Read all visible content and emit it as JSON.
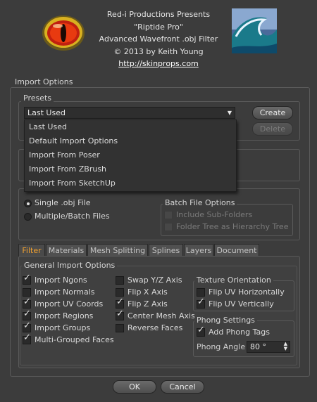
{
  "header": {
    "line1": "Red-i Productions Presents",
    "line2": "\"Riptide Pro\"",
    "line3": "Advanced Wavefront .obj Filter",
    "line4": "© 2013 by Keith Young",
    "link": "http://skinprops.com"
  },
  "import_options": {
    "legend": "Import Options",
    "presets": {
      "legend": "Presets",
      "selected": "Last Used",
      "create_label": "Create",
      "delete_label": "Delete",
      "options": [
        "Last Used",
        "Default Import Options",
        "Import From Poser",
        "Import From ZBrush",
        "Import From SketchUp"
      ]
    },
    "mode": {
      "single_label": "Single .obj File",
      "multiple_label": "Multiple/Batch Files",
      "batch_legend": "Batch File Options",
      "include_sub_folders": "Include Sub-Folders",
      "folder_tree": "Folder Tree as Hierarchy Tree"
    }
  },
  "tabs": [
    "Filter",
    "Materials",
    "Mesh Splitting",
    "Splines",
    "Layers",
    "Document"
  ],
  "general": {
    "legend": "General Import Options",
    "col1": [
      "Import Ngons",
      "Import Normals",
      "Import UV Coords",
      "Import Regions",
      "Import Groups",
      "Multi-Grouped Faces"
    ],
    "col2": [
      "Swap Y/Z Axis",
      "Flip X Axis",
      "Flip Z Axis",
      "Center Mesh Axis",
      "Reverse Faces"
    ]
  },
  "texture": {
    "legend": "Texture Orientation",
    "flip_h": "Flip UV Horizontally",
    "flip_v": "Flip UV Vertically"
  },
  "phong": {
    "legend": "Phong Settings",
    "add_tags": "Add Phong Tags",
    "angle_label": "Phong Angle",
    "angle_value": "80 °"
  },
  "footer": {
    "ok": "OK",
    "cancel": "Cancel"
  },
  "checked": {
    "col1": [
      true,
      false,
      true,
      true,
      true,
      true
    ],
    "col2": [
      false,
      false,
      true,
      true,
      false
    ],
    "flip_h": false,
    "flip_v": true,
    "add_tags": true
  },
  "colors": {
    "accent_tab": "#f0a030",
    "background": "#3c3c3c"
  }
}
